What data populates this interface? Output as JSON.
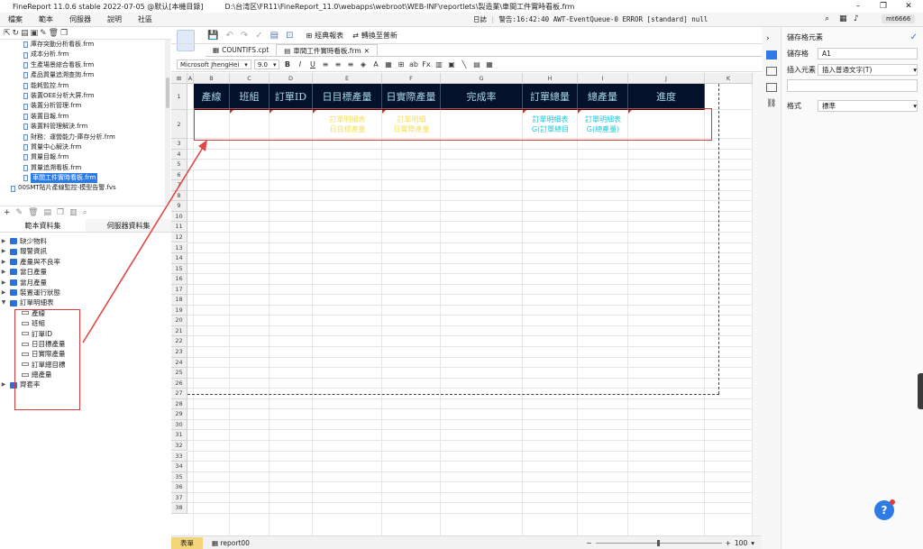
{
  "app": {
    "title": "FineReport 11.0.6 stable 2022-07-05 @默认[本機目錄]",
    "path": "D:\\台湾区\\FR11\\FineReport_11.0\\webapps\\webroot\\WEB-INF\\reportlets\\製造業\\車間工件實時看板.frm"
  },
  "menu": [
    "檔案",
    "範本",
    "伺服器",
    "說明",
    "社區"
  ],
  "status": {
    "log_label": "日誌",
    "message": "警告:16:42:40 AWT-EventQueue-0 ERROR [standard] null",
    "user": "mt6666"
  },
  "file_tree": [
    "庫存突動分析看板.frm",
    "成本分析.frm",
    "生產場景綜合看板.frm",
    "產品質量追溯查詢.frm",
    "能耗監控.frm",
    "裝置OEE分析大屏.frm",
    "裝置分析管理.frm",
    "裝置目報.frm",
    "裝置料管理解決.frm",
    "財務：運營能力-庫存分析.frm",
    "質量中心解決.frm",
    "質量目報.frm",
    "質量追溯看板.frm",
    "車間工件實時看板.frm",
    "00SMT貼片產線監控-模型告警.fvs"
  ],
  "datasource": {
    "tabs": [
      "範本資料集",
      "伺服器資料集"
    ],
    "items": [
      "缺少物料",
      "報警資訊",
      "產量與不良率",
      "當日產量",
      "當月產量",
      "裝置運行狀態",
      "訂單明細表"
    ],
    "fields": [
      "產線",
      "班組",
      "訂單ID",
      "日目標產量",
      "日實際產量",
      "訂單總目標",
      "總產量"
    ],
    "after": "齊套率"
  },
  "toolbar": {
    "classic_label": "經典報表",
    "convert_label": "轉換至普新"
  },
  "file_tabs": [
    "COUNTIFS.cpt",
    "車間工件實時看板.frm"
  ],
  "format": {
    "font": "Microsoft JhengHei",
    "size": "9.0"
  },
  "sheet": {
    "columns": [
      "A",
      "B",
      "C",
      "D",
      "E",
      "F",
      "G",
      "H",
      "I",
      "J",
      "K"
    ],
    "headers": [
      "產線",
      "班組",
      "訂單ID",
      "日目標產量",
      "日實際產量",
      "完成率",
      "訂單總量",
      "總產量",
      "進度"
    ],
    "data_row": [
      "",
      "",
      "",
      "訂單明細表\n日目標產量",
      "訂單明細\n日實際產量",
      "",
      "訂單明細表\nG(訂單總目",
      "訂單明細表\nG(總產量)",
      ""
    ],
    "rows_count": 38
  },
  "bottom": {
    "tabs": [
      "表單",
      "report00"
    ],
    "zoom": "100"
  },
  "right_panel": {
    "title": "儲存格元素",
    "cell_label": "儲存格",
    "cell_value": "A1",
    "insert_label": "插入元素",
    "insert_value": "插入普通文字(T)",
    "style_label": "格式",
    "style_value": "標準"
  },
  "colors": {
    "header_bg": "#04112b",
    "header_text": "#a9d9ea",
    "accent": "#2f7be6",
    "highlight_box": "#d93a3a"
  }
}
